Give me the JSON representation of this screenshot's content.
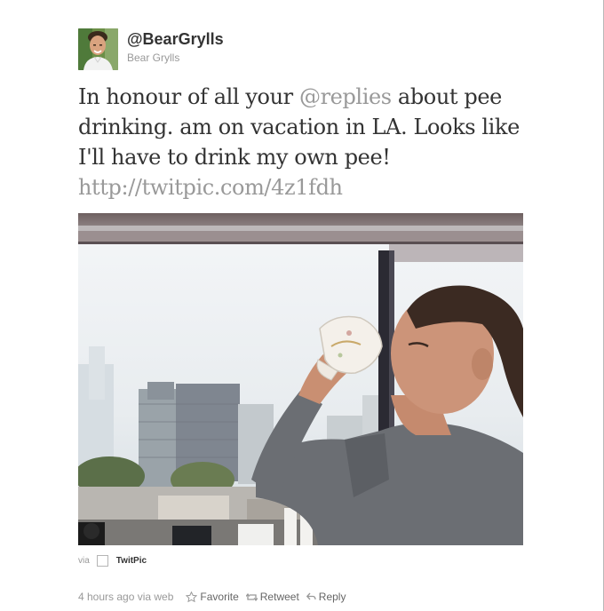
{
  "user": {
    "handle": "@BearGrylls",
    "name": "Bear Grylls"
  },
  "tweet": {
    "text_before_mention": "In honour of all your ",
    "mention_at": "@",
    "mention_name": "replies",
    "text_after_mention": " about pee drinking. am on vacation in LA. Looks like I'll have to drink my own pee!",
    "link": "http://twitpic.com/4z1fdh"
  },
  "attribution": {
    "via_label": "via",
    "app_name": "TwitPic"
  },
  "meta": {
    "timestamp": "4 hours ago via web",
    "actions": {
      "favorite": "Favorite",
      "retweet": "Retweet",
      "reply": "Reply"
    }
  },
  "icons": {
    "favorite": "star-icon",
    "retweet": "retweet-icon",
    "reply": "reply-icon"
  },
  "colors": {
    "text": "#333333",
    "muted": "#999999",
    "action": "#666666"
  }
}
